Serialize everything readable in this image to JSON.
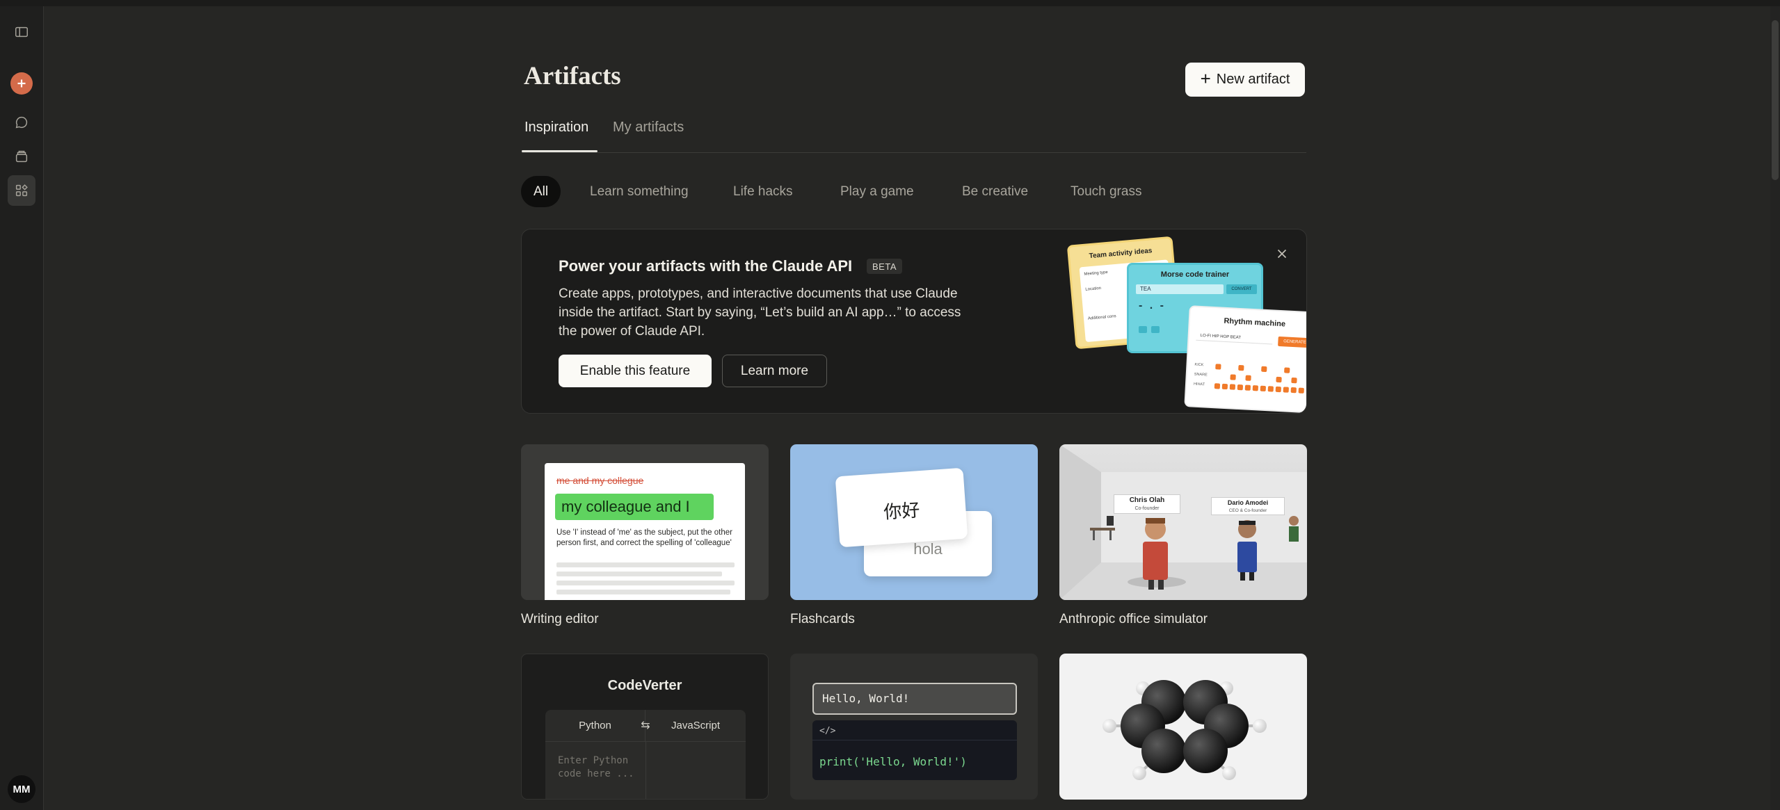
{
  "page": {
    "title": "Artifacts",
    "new_artifact_label": "New artifact"
  },
  "sidebar": {
    "avatar_initials": "MM",
    "icons": [
      "sidebar-toggle-icon",
      "new-chat-icon",
      "chats-icon",
      "projects-icon",
      "artifacts-icon"
    ]
  },
  "tabs": [
    {
      "label": "Inspiration",
      "active": true
    },
    {
      "label": "My artifacts",
      "active": false
    }
  ],
  "categories": [
    {
      "label": "All",
      "active": true
    },
    {
      "label": "Learn something"
    },
    {
      "label": "Life hacks"
    },
    {
      "label": "Play a game"
    },
    {
      "label": "Be creative"
    },
    {
      "label": "Touch grass"
    }
  ],
  "banner": {
    "title": "Power your artifacts with the Claude API",
    "badge": "BETA",
    "description": "Create apps, prototypes, and interactive documents that use Claude inside the artifact. Start by saying, “Let’s build an AI app…” to access the power of Claude API.",
    "enable_label": "Enable this feature",
    "learn_more_label": "Learn more",
    "illustration": {
      "card1_title": "Team activity ideas",
      "card1_rows": [
        "Meeting type",
        "Location",
        "Additional cons"
      ],
      "card2_title": "Morse code trainer",
      "card2_input": "TEA",
      "card2_button": "CONVERT",
      "card2_morse": "- . -",
      "card3_title": "Rhythm machine",
      "card3_select": "LO-FI HIP HOP BEAT",
      "card3_button": "GENERATE",
      "card3_rows": [
        "KICK",
        "SNARE",
        "HIHAT"
      ]
    }
  },
  "gallery": [
    {
      "label": "Writing editor",
      "strike_text": "me and my collegue",
      "highlight_text": "my colleague and I",
      "note": "Use 'I' instead of 'me' as the subject, put the other person first, and correct the spelling of 'colleague'"
    },
    {
      "label": "Flashcards",
      "front": "你好",
      "back": "hola"
    },
    {
      "label": "Anthropic office simulator",
      "sign1_name": "Chris Olah",
      "sign1_role": "Co-founder",
      "sign2_name": "Dario Amodei",
      "sign2_role": "CEO & Co-founder"
    },
    {
      "title": "CodeVerter",
      "from_lang": "Python",
      "swap_glyph": "⇆",
      "to_lang": "JavaScript",
      "placeholder": "Enter Python code here ..."
    },
    {
      "input_text": "Hello, World!",
      "code_tag": "</>",
      "code_output": "print('Hello, World!')"
    },
    {}
  ]
}
